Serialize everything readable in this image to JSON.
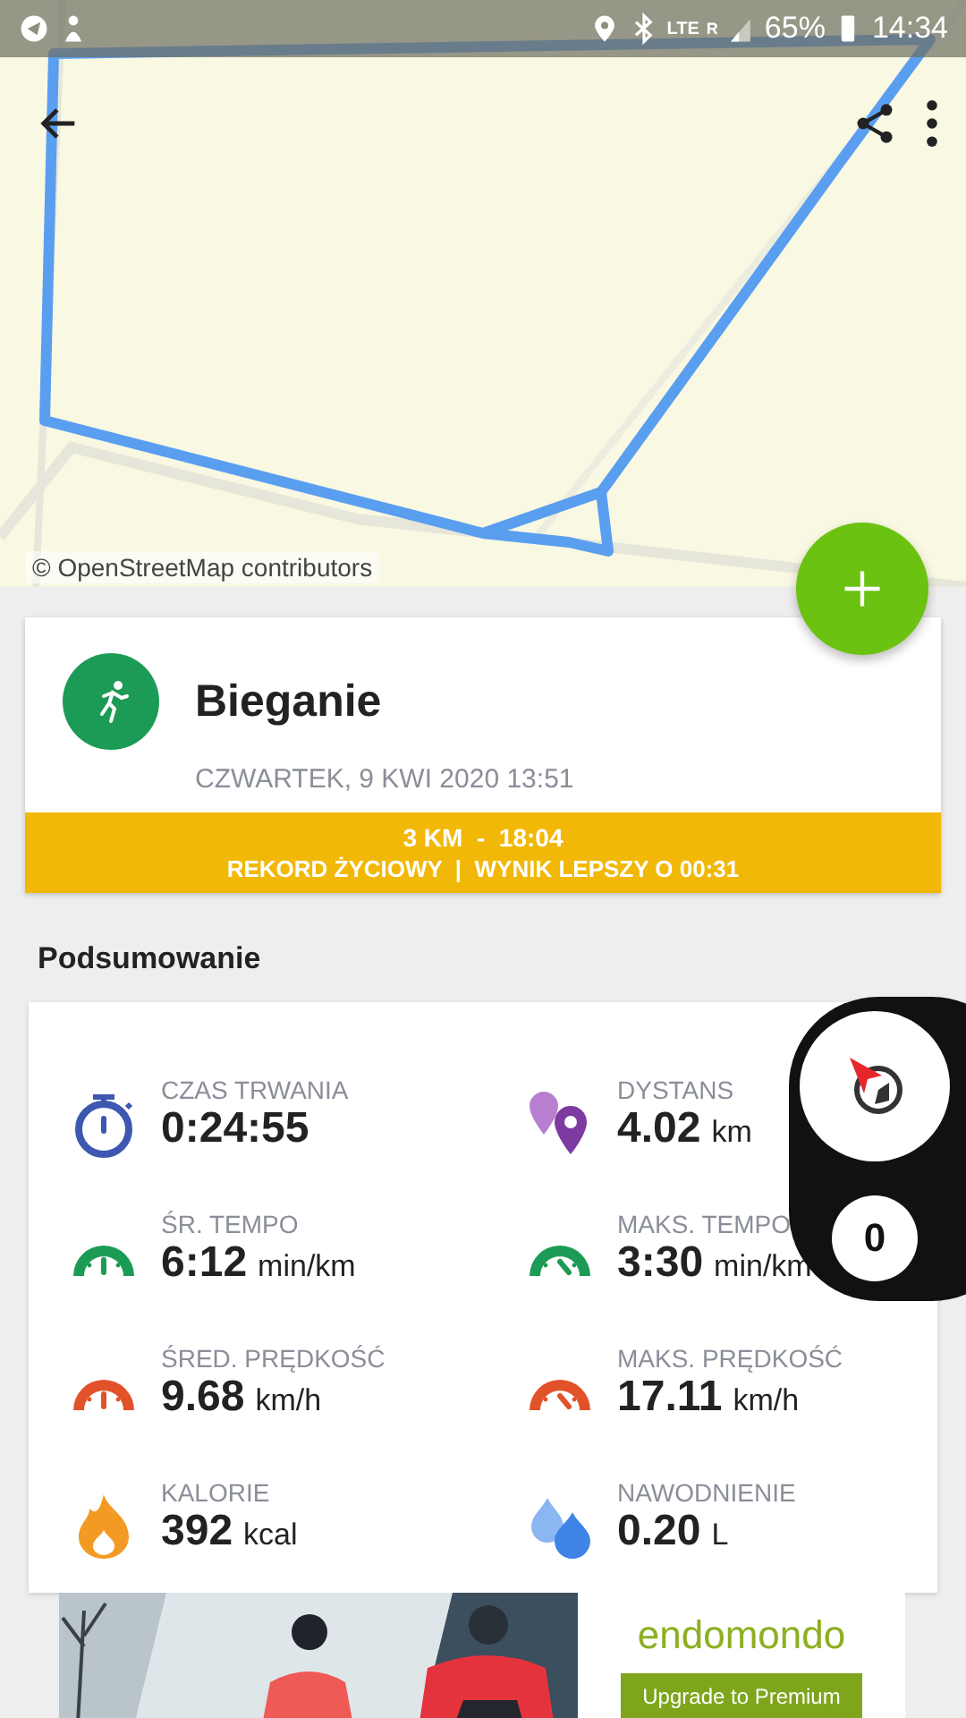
{
  "status_bar": {
    "network": "LTE",
    "roaming": "R",
    "battery": "65%",
    "time": "14:34"
  },
  "map": {
    "attribution": "© OpenStreetMap contributors"
  },
  "activity": {
    "title": "Bieganie",
    "date": "CZWARTEK, 9 KWI 2020 13:51",
    "record_line": "3 KM  -  18:04",
    "record_detail": "REKORD ŻYCIOWY  |  WYNIK LEPSZY O 00:31"
  },
  "summary": {
    "heading": "Podsumowanie",
    "stats": [
      {
        "kind": "duration",
        "label": "CZAS TRWANIA",
        "value": "0:24:55"
      },
      {
        "kind": "distance",
        "label": "DYSTANS",
        "value": "4.02",
        "unit": "km"
      },
      {
        "kind": "pace",
        "label": "ŚR. TEMPO",
        "value": "6:12",
        "unit": "min/km"
      },
      {
        "kind": "max_pace",
        "label": "MAKS. TEMPO",
        "value": "3:30",
        "unit": "min/km"
      },
      {
        "kind": "speed",
        "label": "ŚRED. PRĘDKOŚĆ",
        "value": "9.68",
        "unit": "km/h"
      },
      {
        "kind": "max_speed",
        "label": "MAKS. PRĘDKOŚĆ",
        "value": "17.11",
        "unit": "km/h"
      },
      {
        "kind": "calories",
        "label": "KALORIE",
        "value": "392",
        "unit": "kcal"
      },
      {
        "kind": "hydration",
        "label": "NAWODNIENIE",
        "value": "0.20",
        "unit": "L"
      }
    ]
  },
  "overlay": {
    "count": "0"
  },
  "ad": {
    "brand": "endomondo",
    "button": "Upgrade to Premium"
  }
}
